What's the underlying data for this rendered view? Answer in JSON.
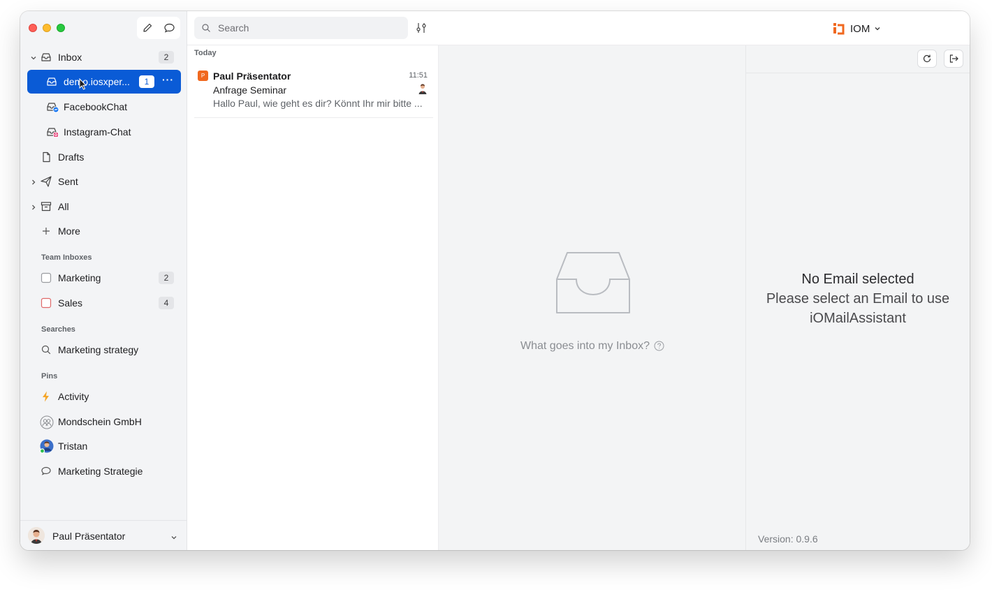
{
  "sidebar": {
    "inbox": {
      "label": "Inbox",
      "count": "2"
    },
    "accounts": [
      {
        "label": "demo.iosxper...",
        "count": "1",
        "more": "···"
      },
      {
        "label": "FacebookChat"
      },
      {
        "label": "Instagram-Chat"
      }
    ],
    "drafts": "Drafts",
    "sent": "Sent",
    "all": "All",
    "more": "More",
    "team_inboxes": {
      "heading": "Team Inboxes",
      "items": [
        {
          "label": "Marketing",
          "count": "2"
        },
        {
          "label": "Sales",
          "count": "4"
        }
      ]
    },
    "searches": {
      "heading": "Searches",
      "items": [
        {
          "label": "Marketing strategy"
        }
      ]
    },
    "pins": {
      "heading": "Pins",
      "items": [
        {
          "label": "Activity"
        },
        {
          "label": "Mondschein GmbH"
        },
        {
          "label": "Tristan"
        },
        {
          "label": "Marketing Strategie"
        }
      ]
    },
    "user": "Paul Präsentator"
  },
  "toolbar": {
    "search_placeholder": "Search",
    "brand": "IOM"
  },
  "mail_list": {
    "day": "Today",
    "items": [
      {
        "badge": "P",
        "sender": "Paul Präsentator",
        "time": "11:51",
        "subject": "Anfrage Seminar",
        "preview": "Hallo Paul, wie geht es dir? Könnt Ihr mir bitte ..."
      }
    ]
  },
  "empty_state": {
    "text": "What goes into my Inbox?"
  },
  "assistant": {
    "line1": "No Email selected",
    "line2": "Please select an Email to use",
    "line3": "iOMailAssistant",
    "version": "Version: 0.9.6"
  },
  "colors": {
    "accent": "#0a5bd6",
    "brand_orange": "#f0681f"
  }
}
